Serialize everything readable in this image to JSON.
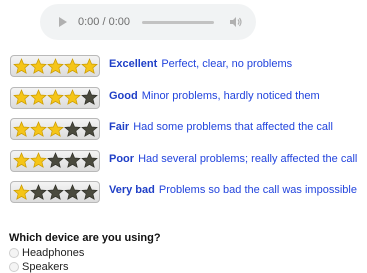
{
  "audio_player": {
    "time": "0:00 / 0:00",
    "progress": 0
  },
  "colors": {
    "label": "#1f3fc7",
    "description": "#2244dd",
    "star_filled": "#f5c518",
    "star_empty": "#4a4a3e"
  },
  "ratings": [
    {
      "label": "Excellent",
      "description": "Perfect, clear, no problems",
      "stars_filled": 5,
      "stars_total": 5
    },
    {
      "label": "Good",
      "description": "Minor problems, hardly noticed them",
      "stars_filled": 4,
      "stars_total": 5
    },
    {
      "label": "Fair",
      "description": "Had some problems that affected the call",
      "stars_filled": 3,
      "stars_total": 5
    },
    {
      "label": "Poor",
      "description": "Had several problems; really affected the call",
      "stars_filled": 2,
      "stars_total": 5
    },
    {
      "label": "Very bad",
      "description": "Problems so bad the call was impossible",
      "stars_filled": 1,
      "stars_total": 5
    }
  ],
  "device_question": {
    "title": "Which device are you using?",
    "options": [
      "Headphones",
      "Speakers"
    ]
  }
}
